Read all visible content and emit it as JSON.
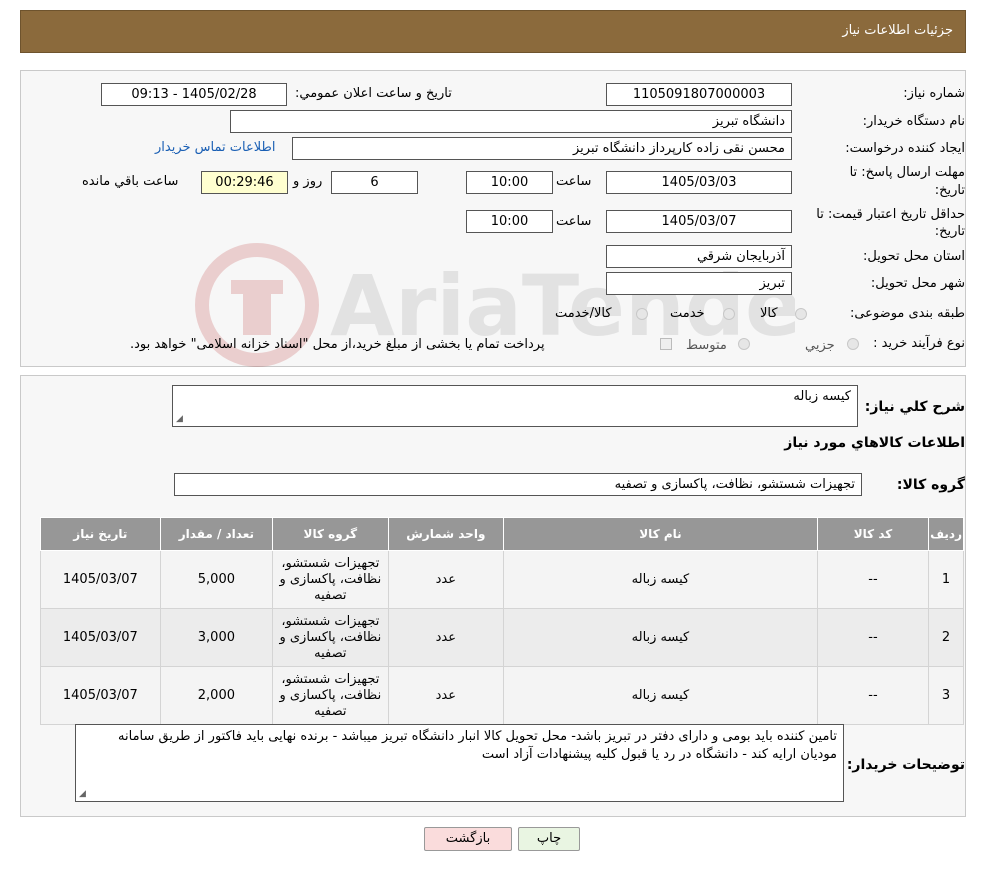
{
  "header": {
    "title": "جزئیات اطلاعات نیاز"
  },
  "form": {
    "need_number_label": "شماره نیاز:",
    "need_number": "1105091807000003",
    "announce_label": "تاریخ و ساعت اعلان عمومي:",
    "announce_value": "1405/02/28 - 09:13",
    "buyer_org_label": "نام دستگاه خريدار:",
    "buyer_org": "دانشگاه تبریز",
    "requester_label": "ايجاد کننده درخواست:",
    "requester": "محسن  نقی زاده کارپرداز دانشگاه تبریز",
    "contact_link": "اطلاعات تماس خريدار",
    "reply_deadline_label_1": "مهلت ارسال پاسخ: تا",
    "reply_deadline_label_2": "تاریخ:",
    "reply_date": "1405/03/03",
    "time_label": "ساعت",
    "reply_time": "10:00",
    "days_value": "6",
    "days_label": "روز و",
    "remaining_time": "00:29:46",
    "remaining_label": "ساعت باقي مانده",
    "validity_label_1": "حداقل تاريخ اعتبار قيمت: تا",
    "validity_label_2": "تاریخ:",
    "validity_date": "1405/03/07",
    "validity_time": "10:00",
    "province_label": "استان محل تحويل:",
    "province": "آذربايجان شرقي",
    "city_label": "شهر محل تحويل:",
    "city": "تبریز",
    "category_label": "طبقه بندی موضوعی:",
    "category_options": [
      "کالا",
      "خدمت",
      "کالا/خدمت"
    ],
    "process_label": "نوع فرآيند خريد :",
    "process_options": [
      "جزيي",
      "متوسط"
    ],
    "process_note": "پرداخت تمام يا بخشی از مبلغ خريد،از محل \"اسناد خزانه اسلامی\" خواهد بود."
  },
  "watermark": {
    "text": "AriaTender.neT"
  },
  "details": {
    "summary_label": "شرح کلي نياز:",
    "summary": "کیسه زباله",
    "items_heading": "اطلاعات کالاهاي مورد نياز",
    "group_label": "گروه کالا:",
    "group_value": "تجهیزات شستشو، نظافت، پاکسازی و تصفیه"
  },
  "table": {
    "headers": [
      "رديف",
      "کد کالا",
      "نام کالا",
      "واحد شمارش",
      "گروه کالا",
      "تعداد / مقدار",
      "تاریخ نیاز"
    ],
    "rows": [
      {
        "idx": "1",
        "code": "--",
        "name": "کیسه زباله",
        "unit": "عدد",
        "group": "تجهیزات شستشو، نظافت، پاکسازی و تصفیه",
        "qty": "5,000",
        "date": "1405/03/07"
      },
      {
        "idx": "2",
        "code": "--",
        "name": "کیسه زباله",
        "unit": "عدد",
        "group": "تجهیزات شستشو، نظافت، پاکسازی و تصفیه",
        "qty": "3,000",
        "date": "1405/03/07"
      },
      {
        "idx": "3",
        "code": "--",
        "name": "کیسه زباله",
        "unit": "عدد",
        "group": "تجهیزات شستشو، نظافت، پاکسازی و تصفیه",
        "qty": "2,000",
        "date": "1405/03/07"
      }
    ]
  },
  "notes": {
    "label": "توضيحات خريدار:",
    "text": "تامین کننده باید بومی و دارای دفتر در تبریز باشد- محل تحویل کالا انبار دانشگاه تبریز میباشد - برنده نهایی باید فاکتور از طریق سامانه مودیان ارایه کند - دانشگاه در رد یا قبول کلیه پیشنهادات آزاد است"
  },
  "buttons": {
    "print": "چاپ",
    "back": "بازگشت"
  }
}
